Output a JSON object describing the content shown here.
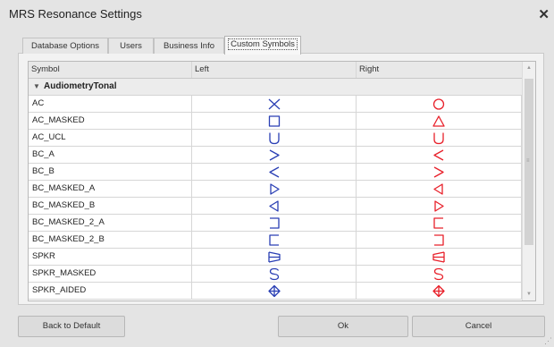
{
  "window": {
    "title": "MRS Resonance Settings",
    "close_glyph": "✕"
  },
  "tabs": [
    {
      "label": "Database Options",
      "active": false
    },
    {
      "label": "Users",
      "active": false
    },
    {
      "label": "Business Info",
      "active": false
    },
    {
      "label": "Custom Symbols",
      "active": true
    }
  ],
  "grid": {
    "columns": [
      "Symbol",
      "Left",
      "Right"
    ],
    "group": "AudiometryTonal",
    "rows": [
      {
        "name": "AC",
        "left_icon": "x-mark-icon",
        "right_icon": "circle-icon"
      },
      {
        "name": "AC_MASKED",
        "left_icon": "square-icon",
        "right_icon": "triangle-icon"
      },
      {
        "name": "AC_UCL",
        "left_icon": "u-shape-icon",
        "right_icon": "u-shape-icon"
      },
      {
        "name": "BC_A",
        "left_icon": "greater-than-icon",
        "right_icon": "less-than-icon"
      },
      {
        "name": "BC_B",
        "left_icon": "less-than-icon",
        "right_icon": "greater-than-icon"
      },
      {
        "name": "BC_MASKED_A",
        "left_icon": "triangle-right-icon",
        "right_icon": "triangle-left-icon"
      },
      {
        "name": "BC_MASKED_B",
        "left_icon": "triangle-left-icon",
        "right_icon": "triangle-right-icon"
      },
      {
        "name": "BC_MASKED_2_A",
        "left_icon": "bracket-right-icon",
        "right_icon": "bracket-left-icon"
      },
      {
        "name": "BC_MASKED_2_B",
        "left_icon": "bracket-left-icon",
        "right_icon": "bracket-right-icon"
      },
      {
        "name": "SPKR",
        "left_icon": "speaker-right-icon",
        "right_icon": "speaker-left-icon"
      },
      {
        "name": "SPKR_MASKED",
        "left_icon": "letter-s-icon",
        "right_icon": "letter-s-icon"
      },
      {
        "name": "SPKR_AIDED",
        "left_icon": "diamond-cross-icon",
        "right_icon": "diamond-cross-icon"
      }
    ]
  },
  "buttons": {
    "back_to_default": "Back to Default",
    "ok": "Ok",
    "cancel": "Cancel"
  },
  "colors": {
    "left_symbol": "#2a3fb4",
    "right_symbol": "#e8202a"
  }
}
